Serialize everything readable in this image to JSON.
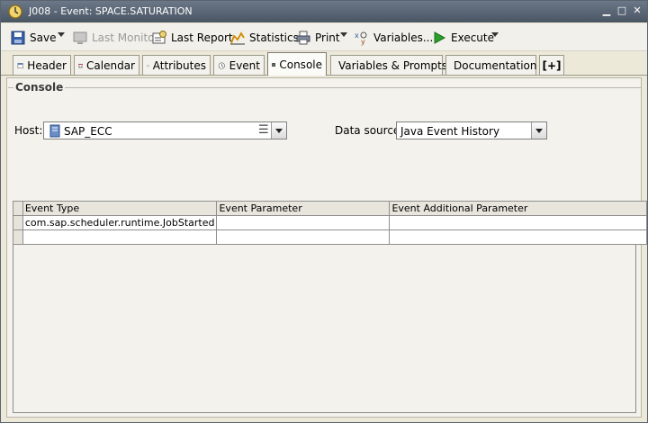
{
  "window": {
    "title": "J008 - Event: SPACE.SATURATION"
  },
  "toolbar": {
    "save_label": "Save",
    "last_monitor_label": "Last Monitor",
    "last_report_label": "Last Report",
    "statistics_label": "Statistics",
    "print_label": "Print",
    "variables_label": "Variables...",
    "execute_label": "Execute"
  },
  "tabs": [
    {
      "label": "Header",
      "icon": "header-icon"
    },
    {
      "label": "Calendar",
      "icon": "calendar-icon",
      "icon_text": "12"
    },
    {
      "label": "Attributes",
      "icon": "attributes-icon"
    },
    {
      "label": "Event",
      "icon": "event-icon"
    },
    {
      "label": "Console",
      "icon": "console-icon",
      "active": true
    },
    {
      "label": "Variables & Prompts",
      "icon": "variables-icon"
    },
    {
      "label": "Documentation",
      "icon": "documentation-icon"
    },
    {
      "label": "[+]",
      "icon": "add-tab-icon"
    }
  ],
  "console": {
    "group_label": "Console",
    "host_label": "Host:",
    "host_value": "SAP_ECC",
    "datasource_label": "Data source:",
    "datasource_value": "Java Event History"
  },
  "table": {
    "columns": [
      "Event Type",
      "Event Parameter",
      "Event Additional Parameter"
    ],
    "rows": [
      [
        "com.sap.scheduler.runtime.JobStarted",
        "",
        ""
      ],
      [
        "",
        "",
        ""
      ]
    ]
  },
  "colors": {
    "titlebar": "#5a6676",
    "execute_green": "#2aa02a",
    "tab_active": "#fbfbf8"
  }
}
